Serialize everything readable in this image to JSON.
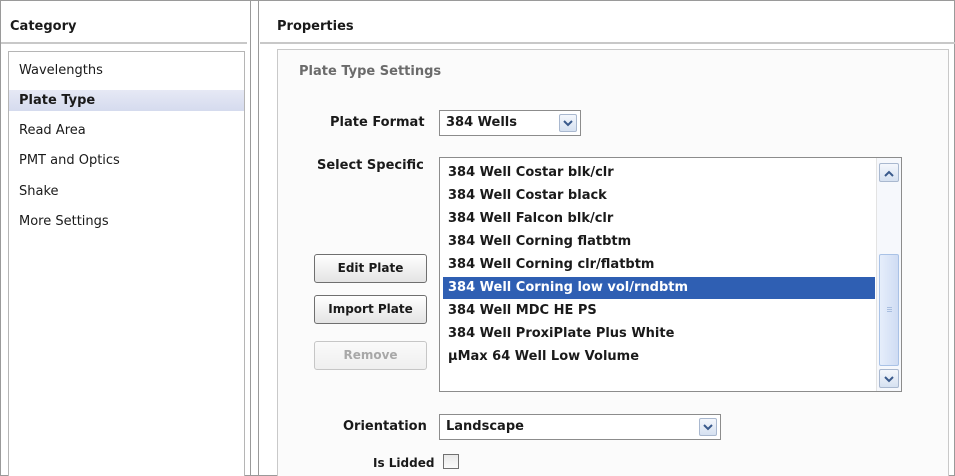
{
  "category": {
    "title": "Category",
    "items": [
      {
        "label": "Wavelengths",
        "selected": false
      },
      {
        "label": "Plate Type",
        "selected": true
      },
      {
        "label": "Read Area",
        "selected": false
      },
      {
        "label": "PMT and Optics",
        "selected": false
      },
      {
        "label": "Shake",
        "selected": false
      },
      {
        "label": "More Settings",
        "selected": false
      }
    ]
  },
  "properties": {
    "title": "Properties",
    "section_title": "Plate Type Settings",
    "plate_format": {
      "label": "Plate Format",
      "value": "384 Wells"
    },
    "select_specific": {
      "label": "Select Specific",
      "items": [
        "384 Well Costar blk/clr",
        "384 Well Costar black",
        "384 Well Falcon blk/clr",
        "384 Well Corning flatbtm",
        "384 Well Corning clr/flatbtm",
        "384 Well Corning low vol/rndbtm",
        "384 Well MDC HE PS",
        "384 Well ProxiPlate Plus White",
        "µMax 64 Well Low Volume"
      ],
      "selected_item": "384 Well Corning low vol/rndbtm"
    },
    "buttons": {
      "edit_plate": "Edit Plate",
      "import_plate": "Import Plate",
      "remove": "Remove"
    },
    "orientation": {
      "label": "Orientation",
      "value": "Landscape"
    },
    "is_lidded": {
      "label": "Is Lidded",
      "checked": false
    }
  },
  "colors": {
    "selection_blue": "#2f5fb3",
    "category_selection": "#d5dbee",
    "section_title_gray": "#6b6b6b"
  }
}
